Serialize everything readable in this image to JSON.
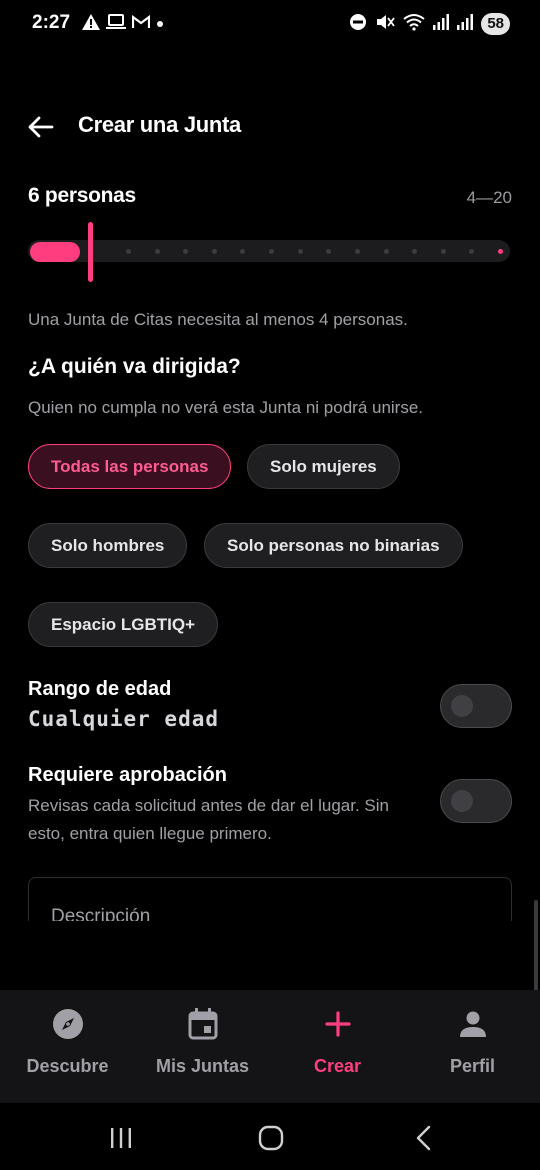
{
  "status_bar": {
    "time": "2:27",
    "battery": "58",
    "left_icons": [
      "warning-icon",
      "laptop-icon",
      "gmail-icon",
      "dot-icon"
    ],
    "right_icons": [
      "do-not-disturb-icon",
      "mute-icon",
      "wifi-icon",
      "signal-icon",
      "signal-icon"
    ]
  },
  "header": {
    "title": "Crear una Junta"
  },
  "persons": {
    "label": "6 personas",
    "range": "4—20",
    "value": 6,
    "min": 4,
    "max": 20,
    "note": "Una Junta de Citas necesita al menos 4 personas."
  },
  "audience": {
    "title": "¿A quién va dirigida?",
    "subtitle": "Quien no cumpla no verá esta Junta ni podrá unirse.",
    "options": [
      {
        "label": "Todas las personas",
        "selected": true
      },
      {
        "label": "Solo mujeres",
        "selected": false
      },
      {
        "label": "Solo hombres",
        "selected": false
      },
      {
        "label": "Solo personas no binarias",
        "selected": false
      },
      {
        "label": "Espacio LGBTIQ+",
        "selected": false
      }
    ]
  },
  "age_range": {
    "title": "Rango de edad",
    "value": "Cualquier edad",
    "enabled": false
  },
  "approval": {
    "title": "Requiere aprobación",
    "description": "Revisas cada solicitud antes de dar el lugar. Sin esto, entra quien llegue primero.",
    "enabled": false
  },
  "description_field": {
    "placeholder": "Descripción"
  },
  "bottom_nav": {
    "items": [
      {
        "label": "Descubre",
        "icon": "compass-icon",
        "active": false
      },
      {
        "label": "Mis Juntas",
        "icon": "calendar-icon",
        "active": false
      },
      {
        "label": "Crear",
        "icon": "plus-icon",
        "active": true
      },
      {
        "label": "Perfil",
        "icon": "person-icon",
        "active": false
      }
    ]
  },
  "colors": {
    "accent": "#ff3d7f",
    "background": "#000000",
    "nav_background": "#141416",
    "muted_text": "#a0a0a6"
  }
}
